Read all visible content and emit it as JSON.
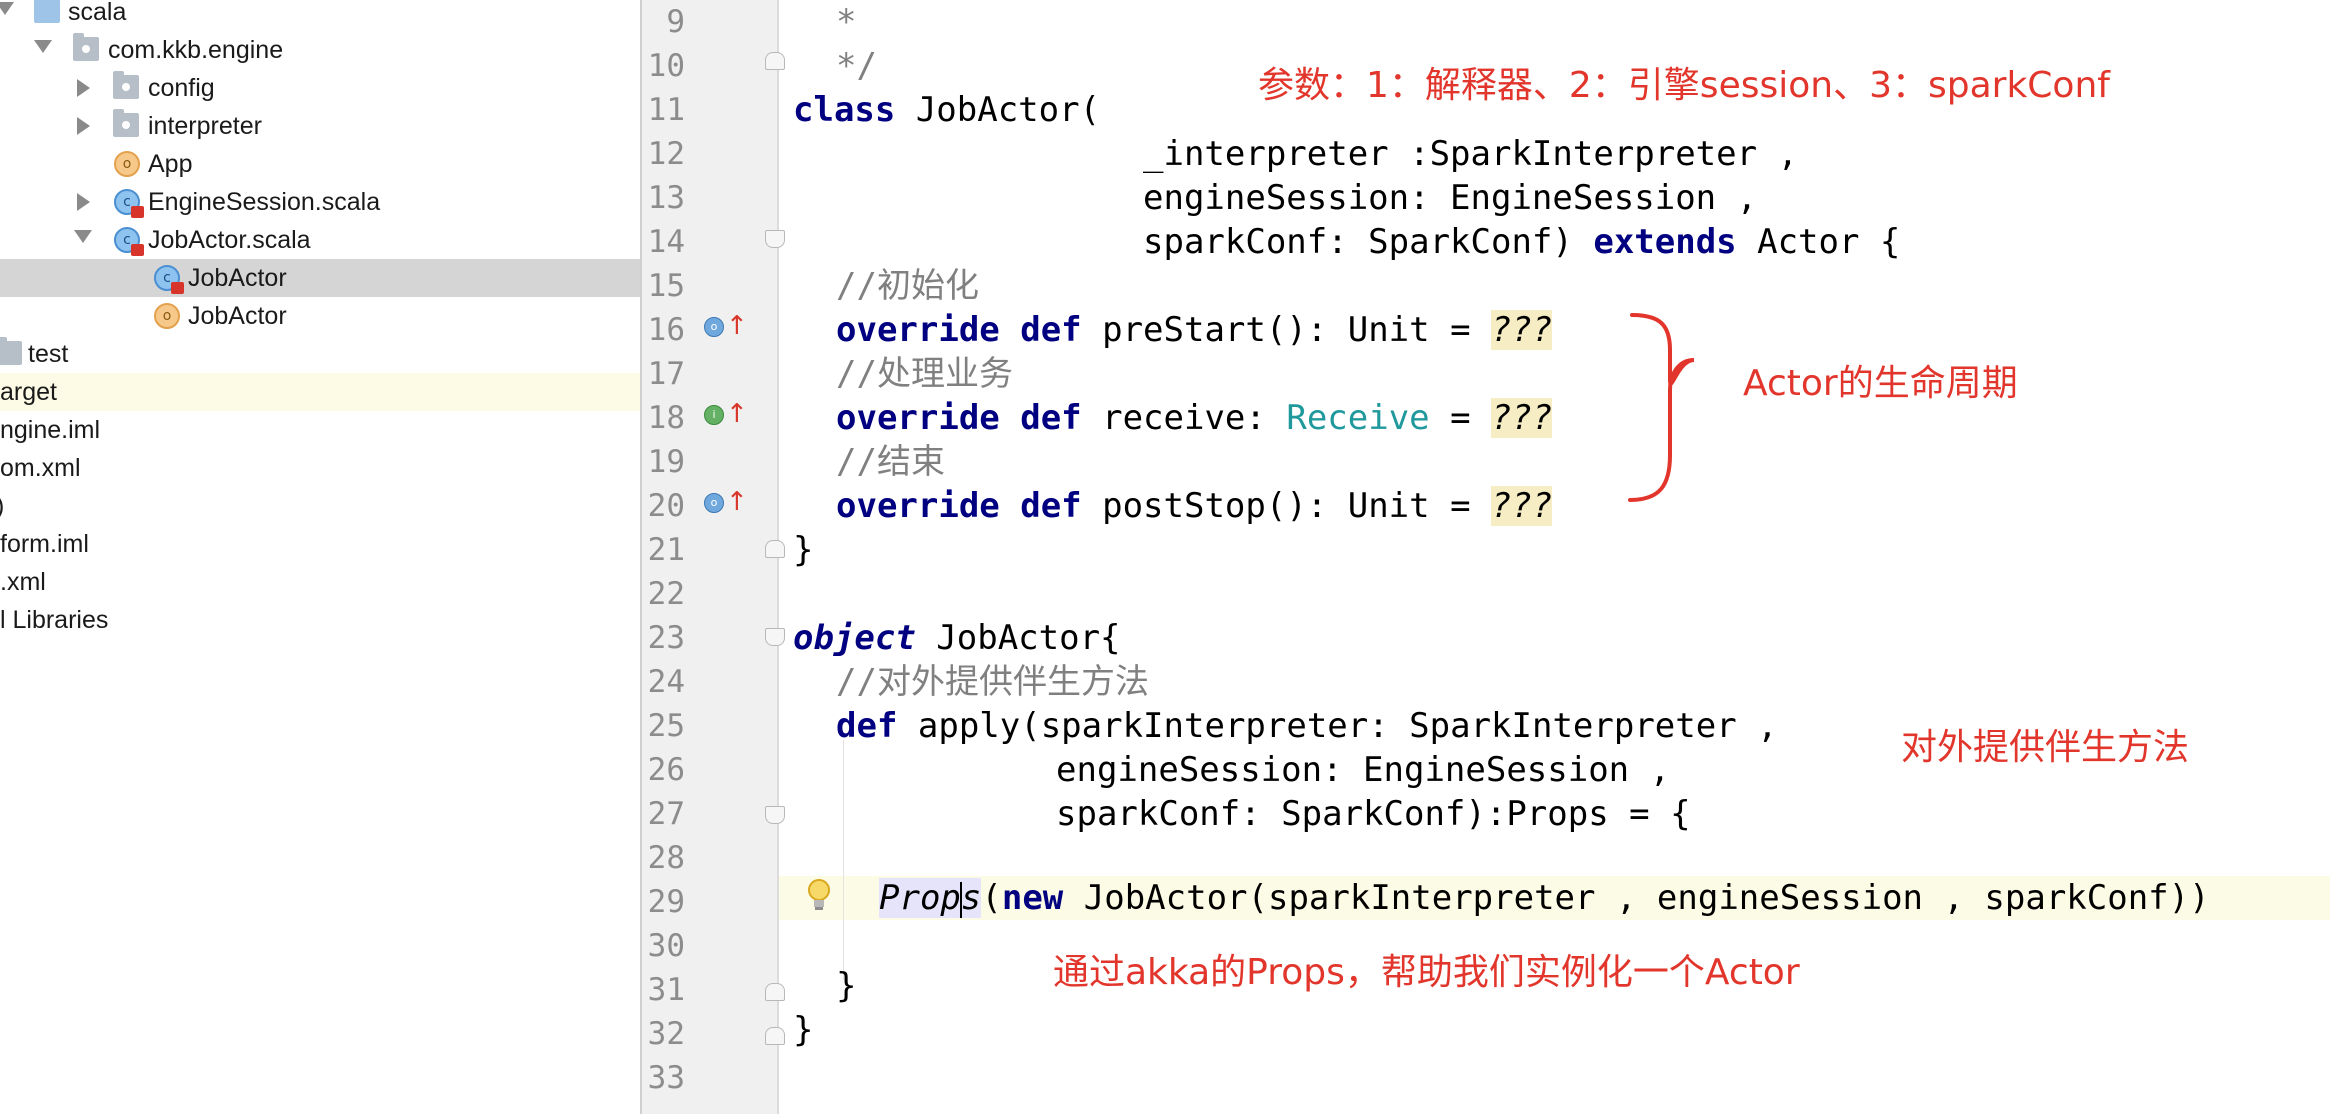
{
  "project_tree": {
    "items": [
      {
        "label": "scala",
        "icon": "folder-icon"
      },
      {
        "label": "com.kkb.engine",
        "icon": "package-icon"
      },
      {
        "label": "config",
        "icon": "package-icon"
      },
      {
        "label": "interpreter",
        "icon": "package-icon"
      },
      {
        "label": "App",
        "icon": "scala-object-icon"
      },
      {
        "label": "EngineSession.scala",
        "icon": "scala-class-file-icon"
      },
      {
        "label": "JobActor.scala",
        "icon": "scala-class-file-icon"
      },
      {
        "label": "JobActor",
        "icon": "scala-class-icon"
      },
      {
        "label": "JobActor",
        "icon": "scala-object-icon"
      },
      {
        "label": "test",
        "icon": "folder-icon"
      },
      {
        "label": "arget",
        "icon": ""
      },
      {
        "label": "ngine.iml",
        "icon": ""
      },
      {
        "label": "om.xml",
        "icon": ""
      },
      {
        "label": ")",
        "icon": ""
      },
      {
        "label": "form.iml",
        "icon": ""
      },
      {
        "label": ".xml",
        "icon": ""
      },
      {
        "label": "l Libraries",
        "icon": ""
      }
    ]
  },
  "editor": {
    "line_numbers": [
      "9",
      "10",
      "11",
      "12",
      "13",
      "14",
      "15",
      "16",
      "17",
      "18",
      "19",
      "20",
      "21",
      "22",
      "23",
      "24",
      "25",
      "26",
      "27",
      "28",
      "29",
      "30",
      "31",
      "32",
      "33"
    ],
    "code": {
      "l9": "*",
      "l10": "*/",
      "l11_kw": "class",
      "l11_rest": " JobActor(",
      "l12": "_interpreter :SparkInterpreter ,",
      "l13": "engineSession: EngineSession ,",
      "l14_a": "sparkConf: SparkConf) ",
      "l14_kw": "extends",
      "l14_b": " Actor {",
      "l15": "//初始化",
      "l16_kw": "override def",
      "l16_rest": " preStart(): Unit = ",
      "l17": "//处理业务",
      "l18_kw": "override def",
      "l18_a": " receive: ",
      "l18_type": "Receive",
      "l18_b": " = ",
      "l19": "//结束",
      "l20_kw": "override def",
      "l20_rest": " postStop(): Unit = ",
      "todo": "???",
      "l21": "}",
      "l23_kw": "object",
      "l23_rest": " JobActor{",
      "l24": "//对外提供伴生方法",
      "l25_kw": "def",
      "l25_rest": " apply(sparkInterpreter: SparkInterpreter ,",
      "l26": "engineSession: EngineSession ,",
      "l27": "sparkConf: SparkConf):Props = {",
      "l29_props_a": "Prop",
      "l29_props_b": "s",
      "l29_a": "(",
      "l29_kw": "new",
      "l29_rest": " JobActor(sparkInterpreter , engineSession , sparkConf))",
      "l31": "}",
      "l32": "}"
    }
  },
  "annotations": {
    "params": "参数：1：解释器、2：引擎session、3：sparkConf",
    "lifecycle": "Actor的生命周期",
    "companion": "对外提供伴生方法",
    "props": "通过akka的Props，帮助我们实例化一个Actor"
  },
  "colors": {
    "annotation": "#e2352b",
    "keyword": "#000080",
    "comment": "#808080",
    "type": "#20999d",
    "todo_bg": "#f7edc4",
    "current_line": "#fcfbe5",
    "selected_row": "#d5d5d5"
  }
}
